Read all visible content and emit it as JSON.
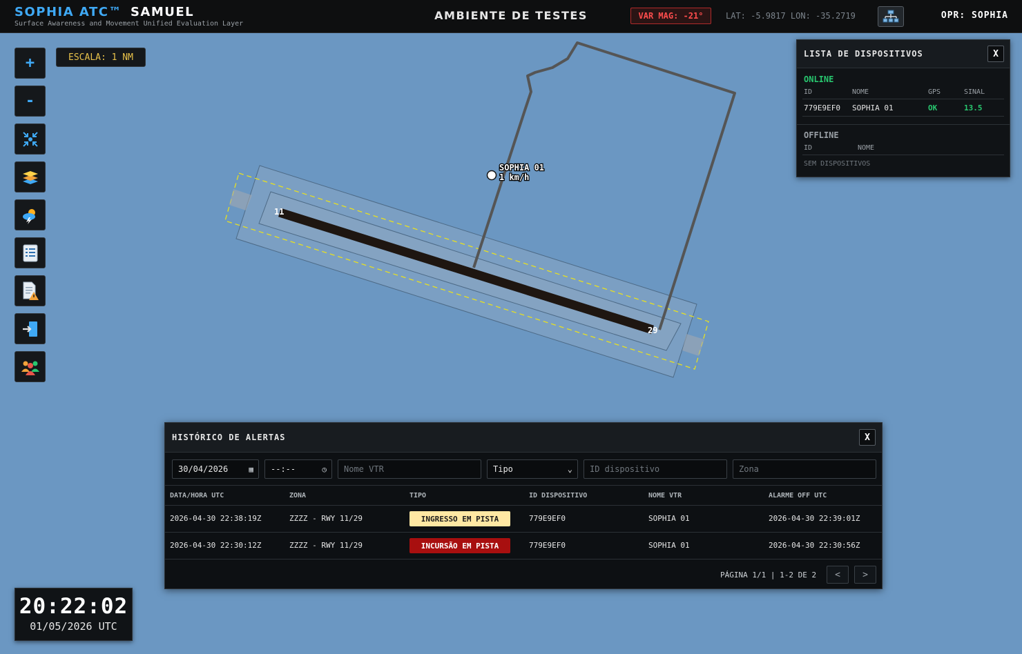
{
  "header": {
    "brand": "SOPHIA ATC™",
    "system": "SAMUEL",
    "subtitle": "Surface Awareness and Movement Unified Evaluation Layer",
    "environment": "AMBIENTE DE TESTES",
    "var_mag": "VAR MAG: -21°",
    "coords": "LAT: -5.9817 LON: -35.2719",
    "operator": "OPR: SOPHIA"
  },
  "toolbar": {
    "zoom_in": "+",
    "zoom_out": "-",
    "scale": "ESCALA: 1 NM"
  },
  "map": {
    "runway_end_a": "11",
    "runway_end_b": "29",
    "vehicle_name": "SOPHIA 01",
    "vehicle_speed": "1 km/h"
  },
  "devices": {
    "title": "LISTA DE DISPOSITIVOS",
    "close": "X",
    "online_title": "ONLINE",
    "online_cols": [
      "ID",
      "NOME",
      "GPS",
      "SINAL"
    ],
    "online_rows": [
      {
        "id": "779E9EF0",
        "name": "SOPHIA 01",
        "gps": "OK",
        "signal": "13.5"
      }
    ],
    "offline_title": "OFFLINE",
    "offline_cols": [
      "ID",
      "NOME"
    ],
    "offline_empty": "SEM DISPOSITIVOS"
  },
  "alerts": {
    "title": "HISTÓRICO DE ALERTAS",
    "close": "X",
    "filters": {
      "date": "30/04/2026",
      "time": "--:--",
      "vtr_placeholder": "Nome VTR",
      "type": "Tipo",
      "device_placeholder": "ID dispositivo",
      "zone_placeholder": "Zona"
    },
    "columns": [
      "DATA/HORA UTC",
      "ZONA",
      "TIPO",
      "ID DISPOSITIVO",
      "NOME VTR",
      "ALARME OFF UTC"
    ],
    "rows": [
      {
        "datetime": "2026-04-30 22:38:19Z",
        "zone": "ZZZZ - RWY 11/29",
        "type": "INGRESSO EM PISTA",
        "device": "779E9EF0",
        "vtr": "SOPHIA 01",
        "off": "2026-04-30 22:39:01Z"
      },
      {
        "datetime": "2026-04-30 22:30:12Z",
        "zone": "ZZZZ - RWY 11/29",
        "type": "INCURSÃO EM PISTA",
        "device": "779E9EF0",
        "vtr": "SOPHIA 01",
        "off": "2026-04-30 22:30:56Z"
      }
    ],
    "pagination": "PÁGINA 1/1 | 1-2 DE 2",
    "prev": "<",
    "next": ">"
  },
  "clock": {
    "time": "20:22:02",
    "date": "01/05/2026 UTC"
  },
  "colors": {
    "accent": "#3fa9f5",
    "online": "#28c76f",
    "alarm": "#a80f0f",
    "warning": "#ffe8a3",
    "map_bg": "#6b97c2"
  }
}
